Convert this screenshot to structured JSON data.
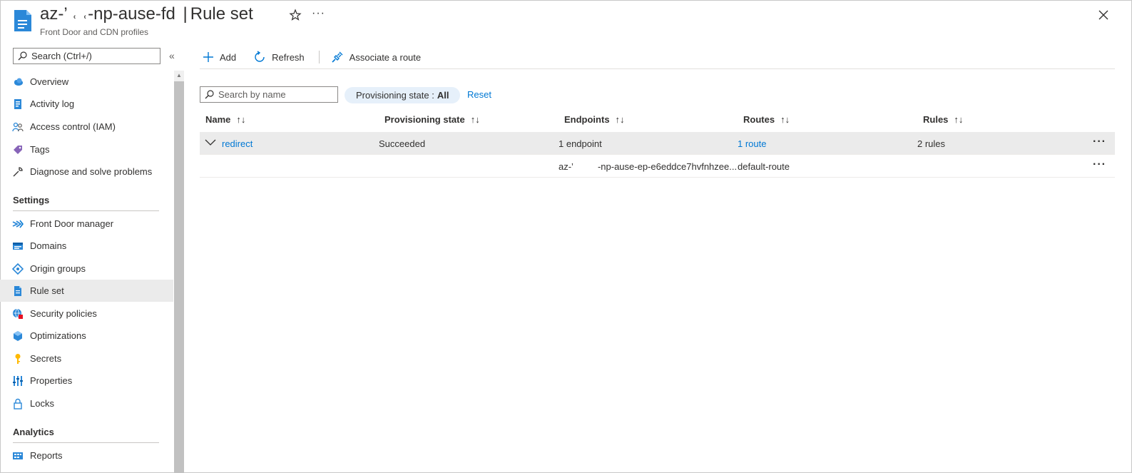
{
  "header": {
    "title_prefix": "az-’ ˓ ˓",
    "title_resource": "-np-ause-fd",
    "title_sep": "|",
    "title_page": "Rule set",
    "subtitle": "Front Door and CDN profiles",
    "more_label": "···"
  },
  "sidebar": {
    "search_placeholder": "Search (Ctrl+/)",
    "collapse_label": "«",
    "items_top": [
      {
        "label": "Overview",
        "icon": "cloud-icon"
      },
      {
        "label": "Activity log",
        "icon": "activity-log-icon"
      },
      {
        "label": "Access control (IAM)",
        "icon": "people-icon"
      },
      {
        "label": "Tags",
        "icon": "tag-icon"
      },
      {
        "label": "Diagnose and solve problems",
        "icon": "wrench-icon"
      }
    ],
    "settings_label": "Settings",
    "items_settings": [
      {
        "label": "Front Door manager",
        "icon": "front-door-icon"
      },
      {
        "label": "Domains",
        "icon": "domains-icon"
      },
      {
        "label": "Origin groups",
        "icon": "origin-groups-icon"
      },
      {
        "label": "Rule set",
        "icon": "rule-set-icon",
        "active": true
      },
      {
        "label": "Security policies",
        "icon": "security-policies-icon"
      },
      {
        "label": "Optimizations",
        "icon": "optimizations-icon"
      },
      {
        "label": "Secrets",
        "icon": "key-icon"
      },
      {
        "label": "Properties",
        "icon": "properties-icon"
      },
      {
        "label": "Locks",
        "icon": "lock-icon"
      }
    ],
    "analytics_label": "Analytics",
    "items_analytics": [
      {
        "label": "Reports",
        "icon": "reports-icon"
      }
    ]
  },
  "toolbar": {
    "add_label": "Add",
    "refresh_label": "Refresh",
    "associate_label": "Associate a route"
  },
  "filters": {
    "search_placeholder": "Search by name",
    "pill_label": "Provisioning state :",
    "pill_value": "All",
    "reset_label": "Reset"
  },
  "table": {
    "columns": [
      "Name",
      "Provisioning state",
      "Endpoints",
      "Routes",
      "Rules"
    ],
    "sort_glyph": "↑↓",
    "group_row": {
      "name": "redirect",
      "state": "Succeeded",
      "endpoints": "1 endpoint",
      "routes": "1 route",
      "rules": "2 rules"
    },
    "child_row": {
      "endpoint_prefix": "az-’",
      "endpoint_suffix": "-np-ause-ep-e6eddce7hvfnhzee...",
      "route": "default-route"
    },
    "more_label": "···"
  },
  "colors": {
    "accent": "#0078d4",
    "active_bg": "#ebebeb",
    "pill_bg": "#e6f0fa"
  }
}
